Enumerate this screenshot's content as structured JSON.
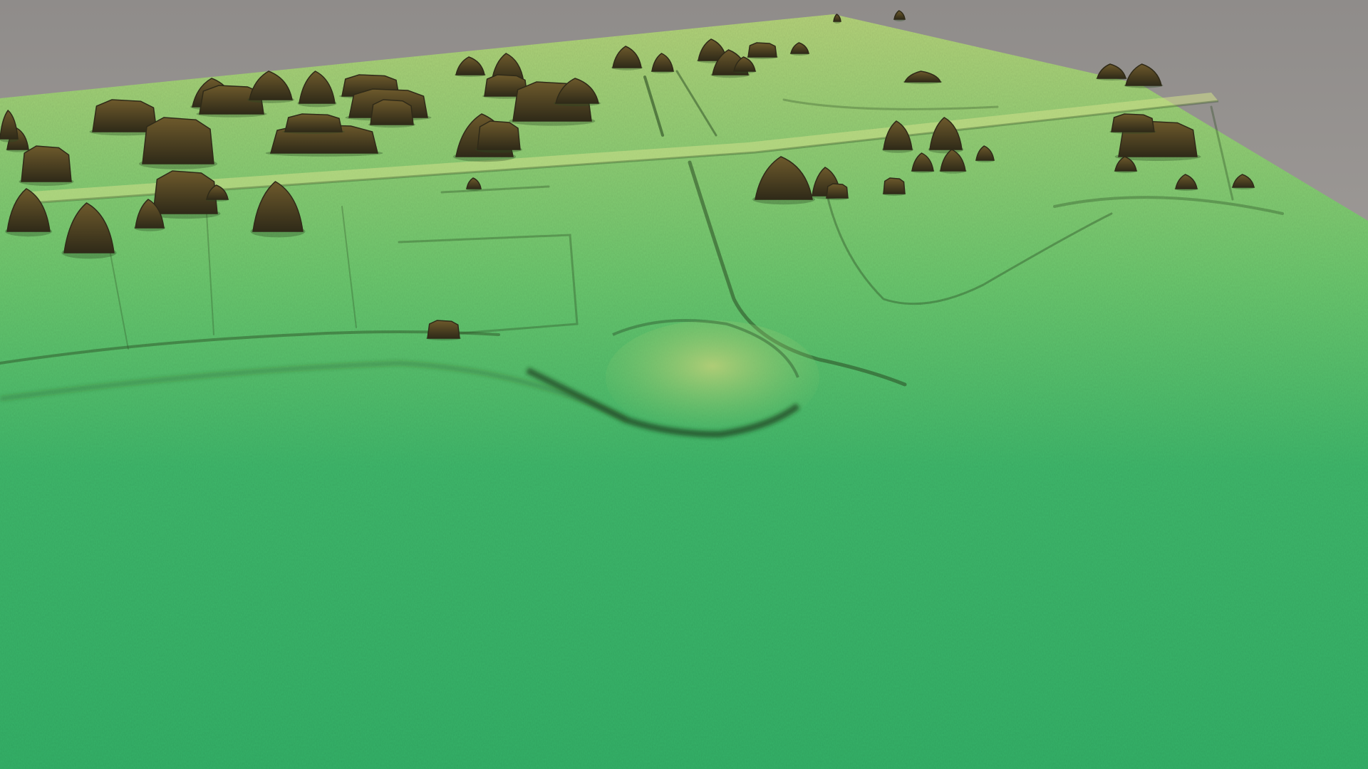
{
  "scene": {
    "kind": "lidar-terrain-render",
    "colors": {
      "sky_top": "#8f8c8a",
      "sky_bottom": "#b7b2ad",
      "terrain_far": "#b5d37a",
      "terrain_mid": "#6cc86e",
      "terrain_near": "#3fb86b",
      "terrain_fore": "#34b268",
      "feature_shadow": "#2a4a22",
      "object_dark": "#2f2a18",
      "object_highlight": "#6e5a2c"
    }
  }
}
